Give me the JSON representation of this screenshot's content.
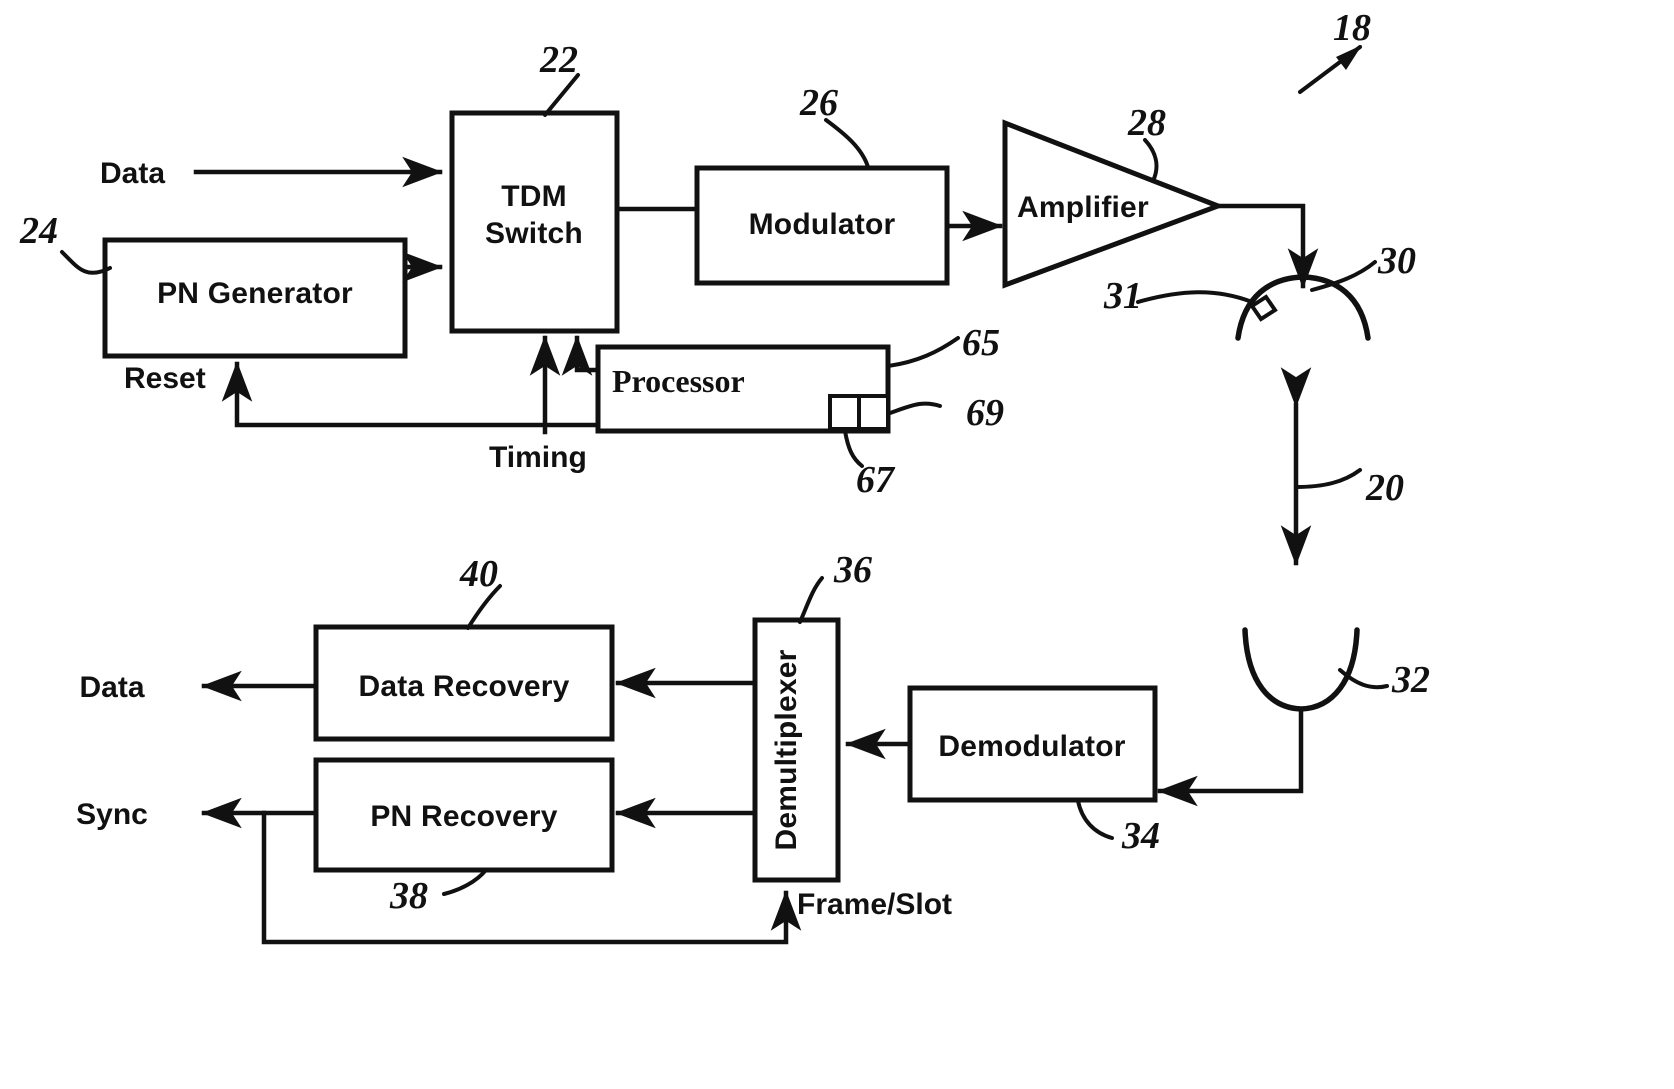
{
  "figure": {
    "type": "patent-block-diagram",
    "overall_ref": "18",
    "link_ref": "20"
  },
  "transmitter": {
    "blocks": [
      {
        "id": "tdm_switch",
        "label_line1": "TDM",
        "label_line2": "Switch",
        "ref": "22"
      },
      {
        "id": "pn_generator",
        "label": "PN Generator",
        "ref": "24"
      },
      {
        "id": "modulator",
        "label": "Modulator",
        "ref": "26"
      },
      {
        "id": "amplifier",
        "label": "Amplifier",
        "ref": "28"
      },
      {
        "id": "processor",
        "label": "Processor",
        "ref": "65"
      }
    ],
    "sub_blocks": [
      {
        "id": "proc_port_left",
        "ref": "67"
      },
      {
        "id": "proc_port_right",
        "ref": "69"
      }
    ],
    "antenna": {
      "id": "tx_antenna",
      "ref": "30",
      "feed_ref": "31"
    },
    "io": [
      {
        "id": "data_in",
        "label": "Data"
      },
      {
        "id": "reset",
        "label": "Reset"
      },
      {
        "id": "timing",
        "label": "Timing"
      }
    ]
  },
  "receiver": {
    "blocks": [
      {
        "id": "demodulator",
        "label": "Demodulator",
        "ref": "34"
      },
      {
        "id": "demultiplexer",
        "label": "Demultiplexer",
        "ref": "36"
      },
      {
        "id": "pn_recovery",
        "label": "PN Recovery",
        "ref": "38"
      },
      {
        "id": "data_recovery",
        "label": "Data Recovery",
        "ref": "40"
      }
    ],
    "antenna": {
      "id": "rx_antenna",
      "ref": "32"
    },
    "io": [
      {
        "id": "data_out",
        "label": "Data"
      },
      {
        "id": "sync_out",
        "label": "Sync"
      },
      {
        "id": "frame_slot",
        "label": "Frame/Slot"
      }
    ]
  },
  "colors": {
    "ink": "#111111",
    "paper": "#ffffff"
  }
}
